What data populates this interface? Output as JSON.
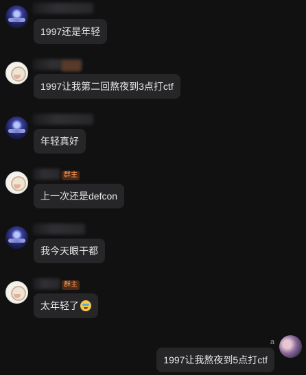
{
  "messages": [
    {
      "text": "1997还是年轻",
      "role_badge": ""
    },
    {
      "text": "1997让我第二回熬夜到3点打ctf",
      "role_badge": ""
    },
    {
      "text": "年轻真好",
      "role_badge": ""
    },
    {
      "text": "上一次还是defcon",
      "role_badge": "群主"
    },
    {
      "text": "我今天眼干都",
      "role_badge": ""
    },
    {
      "text": "太年轻了",
      "role_badge": "群主",
      "emoji": "crying-face"
    }
  ],
  "self_message": {
    "sender": "a",
    "text": "1997让我熬夜到5点打ctf"
  },
  "colors": {
    "background": "#111112",
    "bubble": "#262628",
    "text": "#e8e8ea",
    "badge_text": "#ff9a5a",
    "badge_bg": "#4a2a16"
  }
}
